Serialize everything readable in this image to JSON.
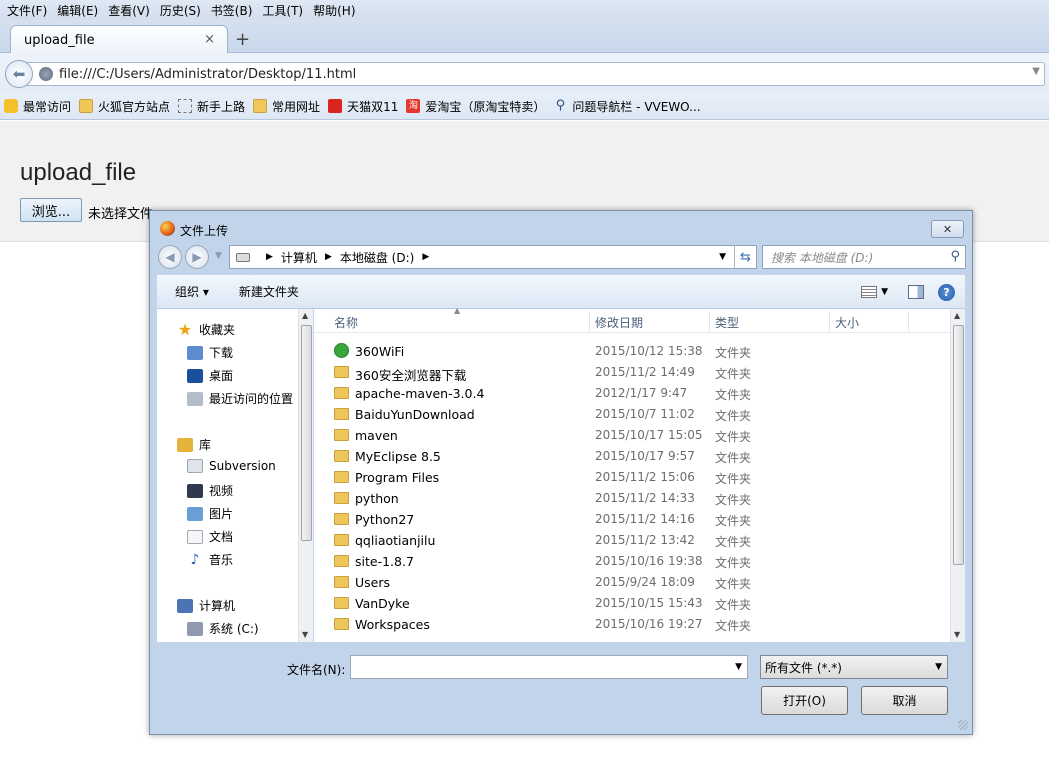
{
  "menu": [
    "文件(F)",
    "编辑(E)",
    "查看(V)",
    "历史(S)",
    "书签(B)",
    "工具(T)",
    "帮助(H)"
  ],
  "tab": {
    "title": "upload_file",
    "close": "×",
    "new": "+"
  },
  "address": {
    "url": "file:///C:/Users/Administrator/Desktop/11.html"
  },
  "bookmarks": [
    "最常访问",
    "火狐官方站点",
    "新手上路",
    "常用网址",
    "天猫双11",
    "爱淘宝（原淘宝特卖）",
    "问题导航栏 - VVEWO..."
  ],
  "page": {
    "heading": "upload_file",
    "browse_label": "浏览...",
    "no_file": "未选择文件"
  },
  "dialog": {
    "title": "文件上传",
    "path": [
      "计算机",
      "本地磁盘 (D:)"
    ],
    "search_placeholder": "搜索 本地磁盘 (D:)",
    "organize": "组织 ▾",
    "new_folder": "新建文件夹",
    "nav": {
      "favorites": "收藏夹",
      "downloads": "下载",
      "desktop": "桌面",
      "recent": "最近访问的位置",
      "libraries": "库",
      "subversion": "Subversion",
      "videos": "视频",
      "pictures": "图片",
      "documents": "文档",
      "music": "音乐",
      "computer": "计算机",
      "system": "系统 (C:)"
    },
    "columns": {
      "name": "名称",
      "date": "修改日期",
      "type": "类型",
      "size": "大小"
    },
    "files": [
      {
        "name": "360WiFi",
        "date": "2015/10/12 15:38",
        "type": "文件夹"
      },
      {
        "name": "360安全浏览器下载",
        "date": "2015/11/2 14:49",
        "type": "文件夹"
      },
      {
        "name": "apache-maven-3.0.4",
        "date": "2012/1/17 9:47",
        "type": "文件夹"
      },
      {
        "name": "BaiduYunDownload",
        "date": "2015/10/7 11:02",
        "type": "文件夹"
      },
      {
        "name": "maven",
        "date": "2015/10/17 15:05",
        "type": "文件夹"
      },
      {
        "name": "MyEclipse 8.5",
        "date": "2015/10/17 9:57",
        "type": "文件夹"
      },
      {
        "name": "Program Files",
        "date": "2015/11/2 15:06",
        "type": "文件夹"
      },
      {
        "name": "python",
        "date": "2015/11/2 14:33",
        "type": "文件夹"
      },
      {
        "name": "Python27",
        "date": "2015/11/2 14:16",
        "type": "文件夹"
      },
      {
        "name": "qqliaotianjilu",
        "date": "2015/11/2 13:42",
        "type": "文件夹"
      },
      {
        "name": "site-1.8.7",
        "date": "2015/10/16 19:38",
        "type": "文件夹"
      },
      {
        "name": "Users",
        "date": "2015/9/24 18:09",
        "type": "文件夹"
      },
      {
        "name": "VanDyke",
        "date": "2015/10/15 15:43",
        "type": "文件夹"
      },
      {
        "name": "Workspaces",
        "date": "2015/10/16 19:27",
        "type": "文件夹"
      }
    ],
    "filename_label": "文件名(N):",
    "filename_value": "",
    "filter": "所有文件 (*.*)",
    "open": "打开(O)",
    "cancel": "取消"
  }
}
